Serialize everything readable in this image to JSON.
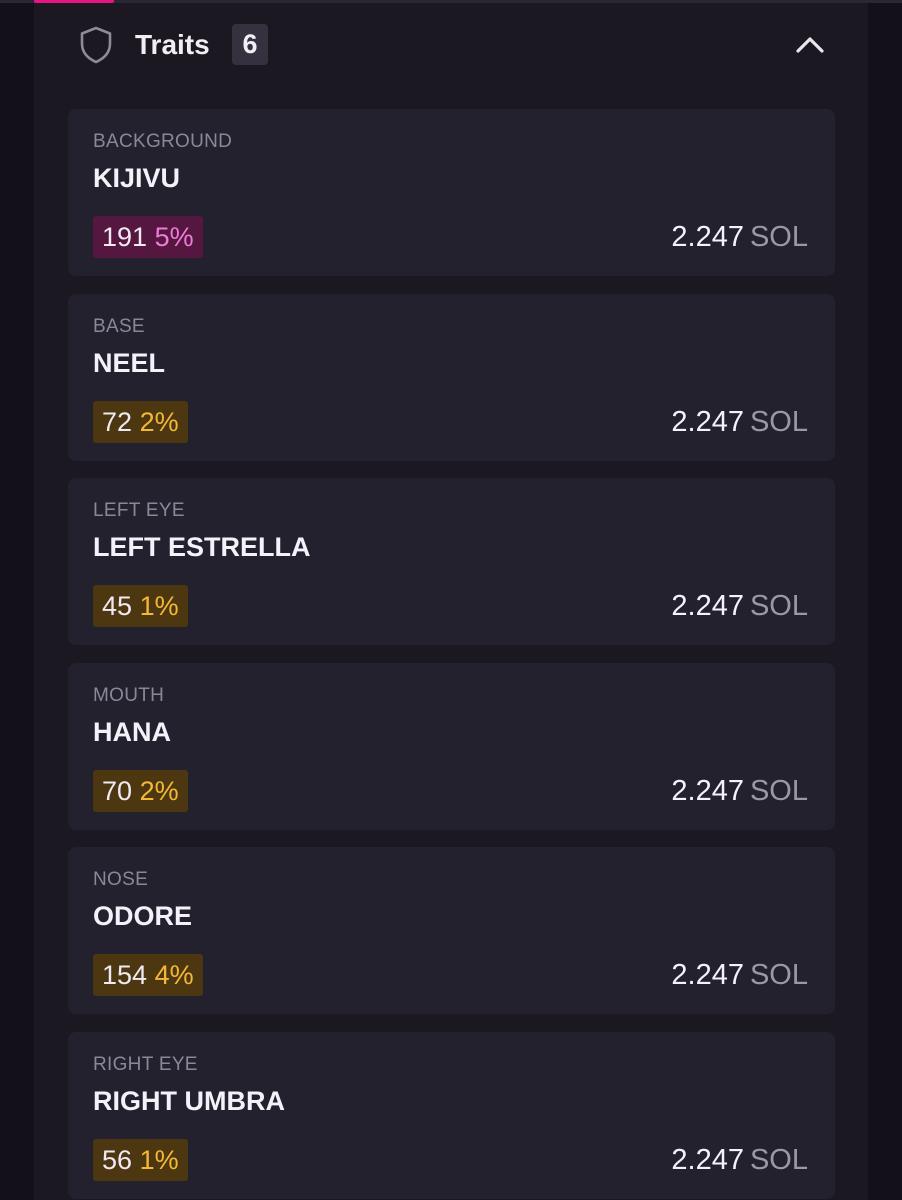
{
  "header": {
    "title": "Traits",
    "count": "6"
  },
  "colors": {
    "accent": "#e6157f",
    "panel_bg": "#1b1822",
    "card_bg": "#24212f",
    "amber_badge": "#f3b836",
    "magenta_badge": "#f07ad9"
  },
  "icons": {
    "header": "shield-icon",
    "collapse": "chevron-up-icon"
  },
  "traits": [
    {
      "type": "BACKGROUND",
      "value": "KIJIVU",
      "count": "191",
      "percent": "5%",
      "badge_color": "magenta",
      "price": "2.247",
      "unit": "SOL"
    },
    {
      "type": "BASE",
      "value": "NEEL",
      "count": "72",
      "percent": "2%",
      "badge_color": "amber",
      "price": "2.247",
      "unit": "SOL"
    },
    {
      "type": "LEFT EYE",
      "value": "LEFT ESTRELLA",
      "count": "45",
      "percent": "1%",
      "badge_color": "amber",
      "price": "2.247",
      "unit": "SOL"
    },
    {
      "type": "MOUTH",
      "value": "HANA",
      "count": "70",
      "percent": "2%",
      "badge_color": "amber",
      "price": "2.247",
      "unit": "SOL"
    },
    {
      "type": "NOSE",
      "value": "ODORE",
      "count": "154",
      "percent": "4%",
      "badge_color": "amber",
      "price": "2.247",
      "unit": "SOL"
    },
    {
      "type": "RIGHT EYE",
      "value": "RIGHT UMBRA",
      "count": "56",
      "percent": "1%",
      "badge_color": "amber",
      "price": "2.247",
      "unit": "SOL"
    }
  ]
}
